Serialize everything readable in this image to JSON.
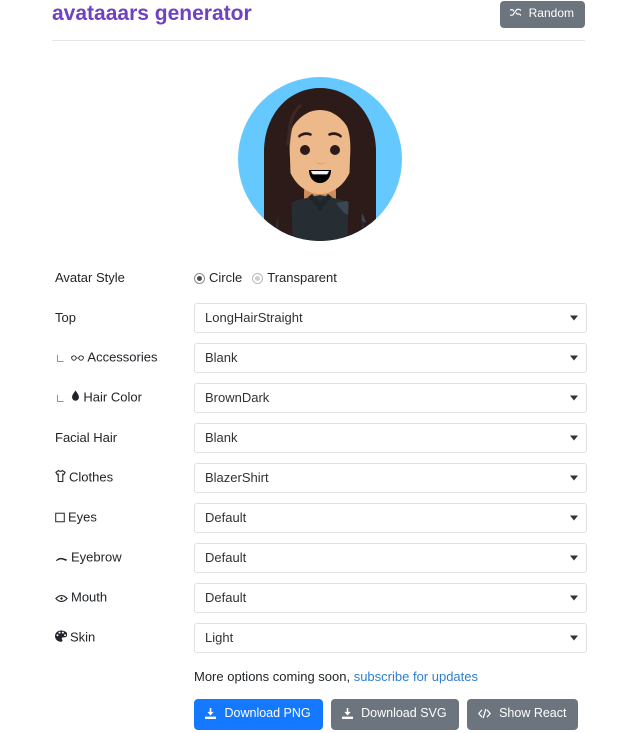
{
  "header": {
    "title": "avataaars generator",
    "random_label": "Random",
    "random_icon": "shuffle-icon"
  },
  "avatar": {
    "alt": "avatar-preview",
    "colors": {
      "background": "#65C9FF",
      "hair": "#2C1B18",
      "hair_highlight": "#4A312C",
      "skin": "#EDB98A",
      "skin_shadow": "#D08B5B",
      "clothes": "#262E33",
      "clothes_highlight": "#3A4750",
      "eyes": "#2C1B18",
      "mouth_inner": "#000000"
    }
  },
  "form": {
    "rows": [
      {
        "label": "Avatar Style",
        "icon": "",
        "indent": false,
        "type": "radio",
        "options": [
          {
            "label": "Circle",
            "selected": true
          },
          {
            "label": "Transparent",
            "selected": false
          }
        ]
      },
      {
        "label": "Top",
        "icon": "",
        "indent": false,
        "type": "select",
        "value": "LongHairStraight"
      },
      {
        "label": "Accessories",
        "icon": "glasses-icon",
        "indent": true,
        "type": "select",
        "value": "Blank"
      },
      {
        "label": "Hair Color",
        "icon": "hair-color-icon",
        "indent": true,
        "type": "select",
        "value": "BrownDark"
      },
      {
        "label": "Facial Hair",
        "icon": "",
        "indent": false,
        "type": "select",
        "value": "Blank"
      },
      {
        "label": "Clothes",
        "icon": "tshirt-icon",
        "indent": false,
        "type": "select",
        "value": "BlazerShirt"
      },
      {
        "label": "Eyes",
        "icon": "eye-square-icon",
        "indent": false,
        "type": "select",
        "value": "Default"
      },
      {
        "label": "Eyebrow",
        "icon": "eyebrow-icon",
        "indent": false,
        "type": "select",
        "value": "Default"
      },
      {
        "label": "Mouth",
        "icon": "mouth-icon",
        "indent": false,
        "type": "select",
        "value": "Default"
      },
      {
        "label": "Skin",
        "icon": "palette-icon",
        "indent": false,
        "type": "select",
        "value": "Light"
      }
    ]
  },
  "footer": {
    "note_prefix": "More options coming soon, ",
    "note_link": "subscribe for updates",
    "buttons": [
      {
        "label": "Download PNG",
        "icon": "download-icon",
        "style": "primary"
      },
      {
        "label": "Download SVG",
        "icon": "download-icon",
        "style": "secondary"
      },
      {
        "label": "Show React",
        "icon": "code-icon",
        "style": "secondary"
      }
    ]
  },
  "colors": {
    "brand_purple": "#6f42c1",
    "primary_blue": "#1479ff",
    "secondary_gray": "#6c757d",
    "link_blue": "#2f7fd1"
  }
}
